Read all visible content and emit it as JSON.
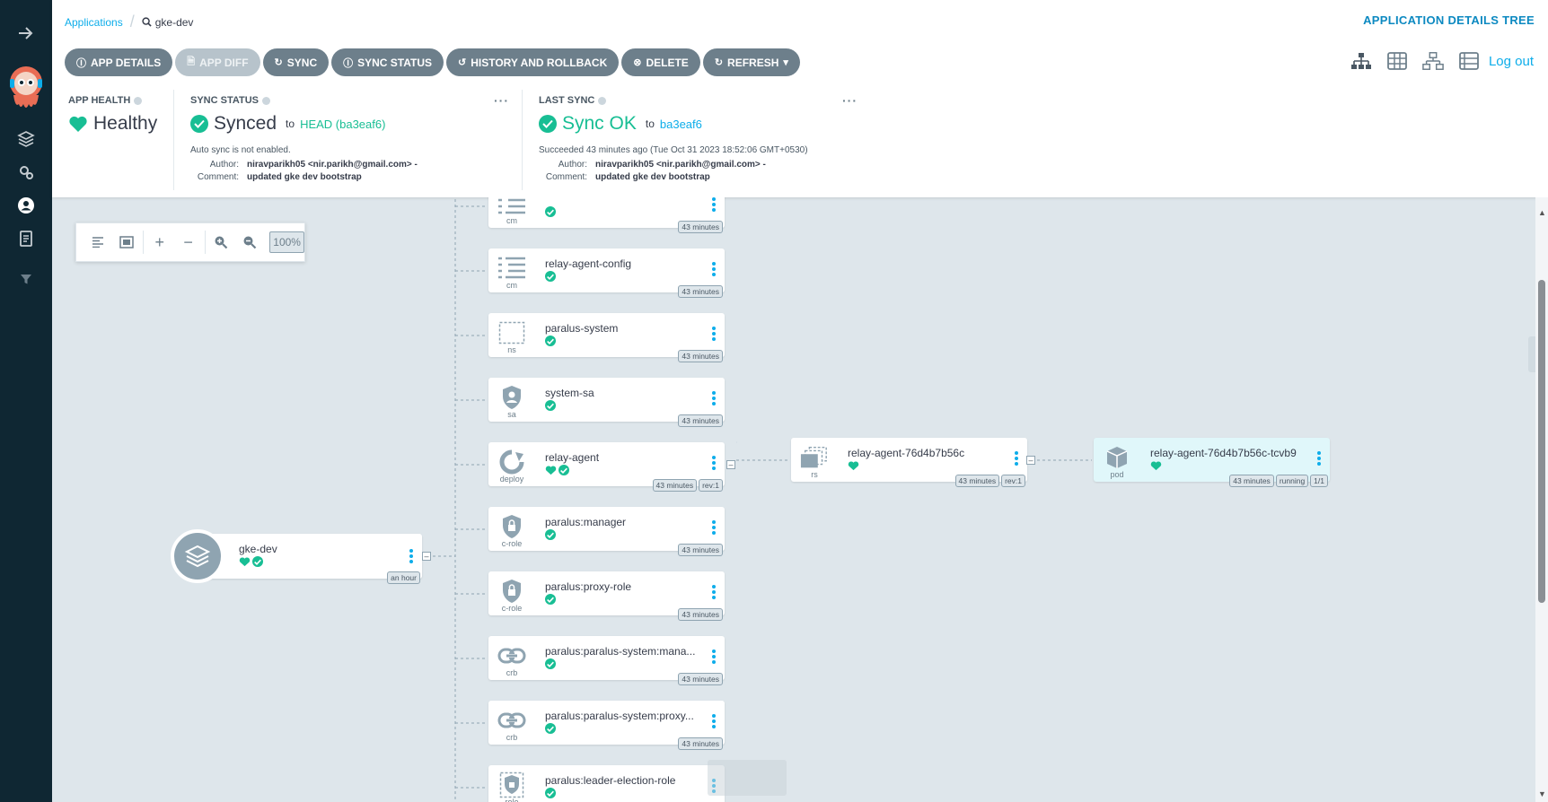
{
  "breadcrumb": {
    "root": "Applications",
    "current": "gke-dev"
  },
  "page_mode": "APPLICATION DETAILS TREE",
  "toolbar": [
    {
      "label": "APP DETAILS",
      "icon": "info-icon",
      "disabled": false
    },
    {
      "label": "APP DIFF",
      "icon": "file-icon",
      "disabled": true
    },
    {
      "label": "SYNC",
      "icon": "sync-icon",
      "disabled": false
    },
    {
      "label": "SYNC STATUS",
      "icon": "info-icon",
      "disabled": false
    },
    {
      "label": "HISTORY AND ROLLBACK",
      "icon": "history-icon",
      "disabled": false
    },
    {
      "label": "DELETE",
      "icon": "times-circle-icon",
      "disabled": false
    },
    {
      "label": "REFRESH",
      "icon": "refresh-icon",
      "disabled": false
    }
  ],
  "logout": "Log out",
  "app_health": {
    "label": "APP HEALTH",
    "value": "Healthy"
  },
  "sync_status": {
    "label": "SYNC STATUS",
    "value": "Synced",
    "to": "to",
    "revision": "HEAD (ba3eaf6)",
    "auto_sync": "Auto sync is not enabled.",
    "author_key": "Author:",
    "author": "niravparikh05 <nir.parikh@gmail.com> -",
    "comment_key": "Comment:",
    "comment": "updated gke dev bootstrap"
  },
  "last_sync": {
    "label": "LAST SYNC",
    "value": "Sync OK",
    "to": "to",
    "revision": "ba3eaf6",
    "succeeded": "Succeeded 43 minutes ago (Tue Oct 31 2023 18:52:06 GMT+0530)",
    "author_key": "Author:",
    "author": "niravparikh05 <nir.parikh@gmail.com> -",
    "comment_key": "Comment:",
    "comment": "updated gke dev bootstrap"
  },
  "zoom": {
    "level": "100%"
  },
  "app_node": {
    "name": "gke-dev",
    "age": "an hour"
  },
  "nodes": [
    {
      "name": "",
      "kind": "cm",
      "age": "43 minutes"
    },
    {
      "name": "relay-agent-config",
      "kind": "cm",
      "age": "43 minutes"
    },
    {
      "name": "paralus-system",
      "kind": "ns",
      "age": "43 minutes"
    },
    {
      "name": "system-sa",
      "kind": "sa",
      "age": "43 minutes"
    },
    {
      "name": "relay-agent",
      "kind": "deploy",
      "age": "43 minutes",
      "rev": "rev:1"
    },
    {
      "name": "paralus:manager",
      "kind": "c-role",
      "age": "43 minutes"
    },
    {
      "name": "paralus:proxy-role",
      "kind": "c-role",
      "age": "43 minutes"
    },
    {
      "name": "paralus:paralus-system:mana...",
      "kind": "crb",
      "age": "43 minutes"
    },
    {
      "name": "paralus:paralus-system:proxy...",
      "kind": "crb",
      "age": "43 minutes"
    },
    {
      "name": "paralus:leader-election-role",
      "kind": "role",
      "age": ""
    }
  ],
  "rs_node": {
    "name": "relay-agent-76d4b7b56c",
    "kind": "rs",
    "age": "43 minutes",
    "rev": "rev:1"
  },
  "pod_node": {
    "name": "relay-agent-76d4b7b56c-tcvb9",
    "kind": "pod",
    "age": "43 minutes",
    "status": "running",
    "ready": "1/1"
  },
  "colors": {
    "sidebar": "#0f2733",
    "accent": "#0dadea",
    "healthy": "#18be94",
    "button": "#6d7f8b"
  }
}
